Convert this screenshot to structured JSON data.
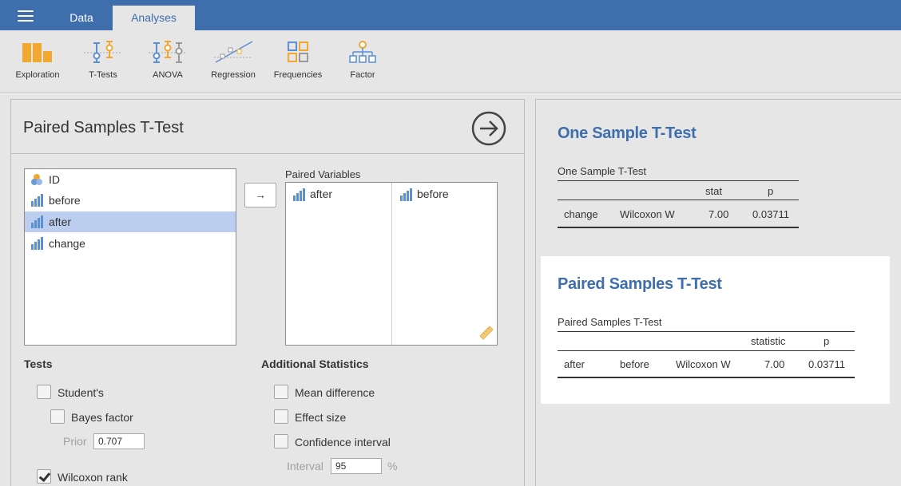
{
  "topbar": {
    "tabs": [
      {
        "label": "Data"
      },
      {
        "label": "Analyses"
      }
    ]
  },
  "ribbon": {
    "items": [
      {
        "label": "Exploration",
        "icon": "exploration-icon"
      },
      {
        "label": "T-Tests",
        "icon": "t-tests-icon"
      },
      {
        "label": "ANOVA",
        "icon": "anova-icon"
      },
      {
        "label": "Regression",
        "icon": "regression-icon"
      },
      {
        "label": "Frequencies",
        "icon": "frequencies-icon"
      },
      {
        "label": "Factor",
        "icon": "factor-icon"
      }
    ]
  },
  "options": {
    "title": "Paired Samples T-Test",
    "variables": [
      {
        "name": "ID",
        "icon": "nominal-variable-icon",
        "selected": false
      },
      {
        "name": "before",
        "icon": "continuous-variable-icon",
        "selected": false
      },
      {
        "name": "after",
        "icon": "continuous-variable-icon",
        "selected": true
      },
      {
        "name": "change",
        "icon": "continuous-variable-icon",
        "selected": false
      }
    ],
    "move_button": "→",
    "paired_label": "Paired Variables",
    "paired_pairs": [
      {
        "left": "after",
        "right": "before"
      }
    ],
    "tests": {
      "heading": "Tests",
      "students": {
        "label": "Student's",
        "checked": false
      },
      "bayes": {
        "label": "Bayes factor",
        "checked": false
      },
      "prior_label": "Prior",
      "prior_value": "0.707",
      "wilcoxon": {
        "label": "Wilcoxon rank",
        "checked": true
      }
    },
    "additional": {
      "heading": "Additional Statistics",
      "mean_diff": {
        "label": "Mean difference",
        "checked": false
      },
      "effect_size": {
        "label": "Effect size",
        "checked": false
      },
      "ci": {
        "label": "Confidence interval",
        "checked": false
      },
      "interval_label": "Interval",
      "interval_value": "95",
      "interval_unit": "%"
    }
  },
  "results": {
    "one_sample": {
      "title": "One Sample T-Test",
      "caption": "One Sample T-Test",
      "headers": [
        "",
        "",
        "stat",
        "p"
      ],
      "rows": [
        [
          "change",
          "Wilcoxon W",
          "7.00",
          "0.03711"
        ]
      ]
    },
    "paired": {
      "title": "Paired Samples T-Test",
      "caption": "Paired Samples T-Test",
      "headers": [
        "",
        "",
        "",
        "statistic",
        "p"
      ],
      "rows": [
        [
          "after",
          "before",
          "Wilcoxon W",
          "7.00",
          "0.03711"
        ]
      ]
    }
  },
  "colors": {
    "accent": "#3e6eab",
    "selection": "#bbcef0",
    "icon_orange": "#f0a830",
    "icon_blue": "#5b8fd6"
  }
}
